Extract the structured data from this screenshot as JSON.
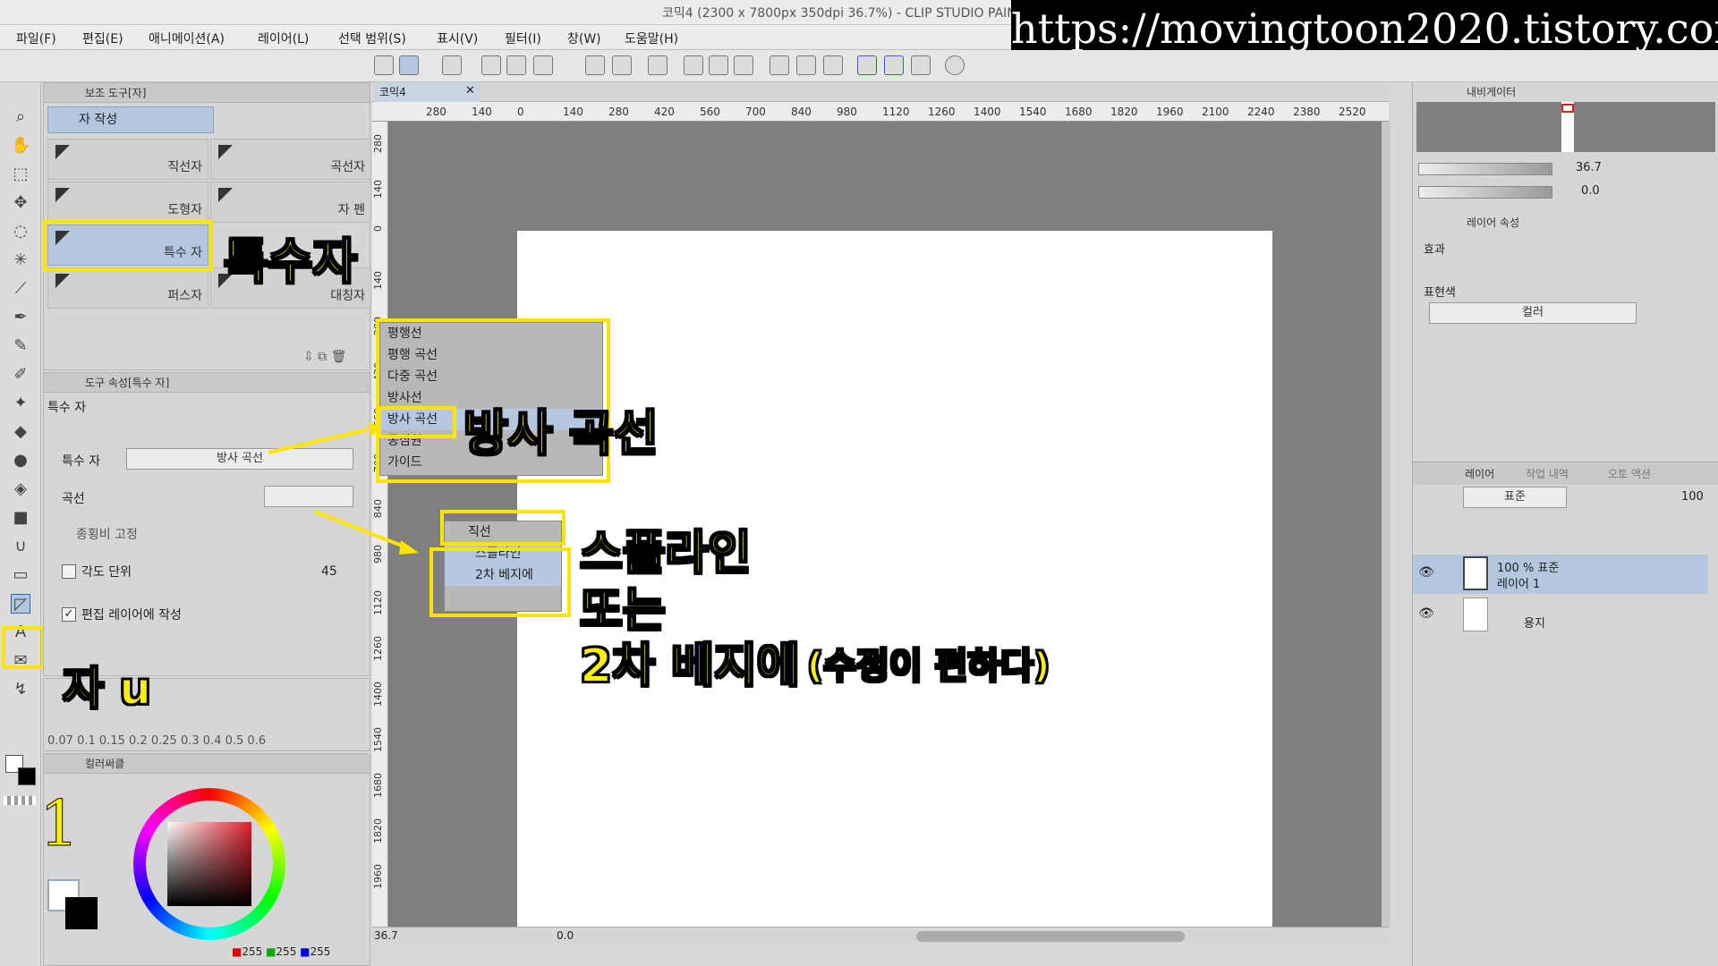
{
  "window": {
    "title": "코믹4 (2300 x 7800px 350dpi 36.7%)  - CLIP STUDIO PAINT"
  },
  "watermark": "https://movingtoon2020.tistory.com",
  "menu": [
    "파일(F)",
    "편집(E)",
    "애니메이션(A)",
    "레이어(L)",
    "선택 범위(S)",
    "표시(V)",
    "필터(I)",
    "창(W)",
    "도움말(H)"
  ],
  "subtool_panel": {
    "title": "보조 도구[자]",
    "group": "자 작성",
    "items": [
      "직선자",
      "곡선자",
      "도형자",
      "자 펜",
      "특수 자",
      "퍼스자",
      "대칭자"
    ],
    "selected": "특수 자"
  },
  "tool_property": {
    "title": "도구 속성[특수 자]",
    "tool_name": "특수 자",
    "rows": {
      "special_label": "특수 자",
      "special_value": "방사 곡선",
      "curve_label": "곡선",
      "aspect_label": "종횡비 고정",
      "angle_label": "각도 단위",
      "angle_value": "45",
      "edit_layer_label": "편집 레이어에 작성"
    }
  },
  "brush_sizes": [
    "0.07",
    "0.1",
    "0.15",
    "0.2",
    "0.25",
    "0.3",
    "0.4",
    "0.5",
    "0.6"
  ],
  "color_panel": {
    "title": "컬러써클",
    "rgb": [
      "255",
      "255",
      "255"
    ]
  },
  "canvas": {
    "tab": "코믹4",
    "ruler_h": [
      "280",
      "140",
      "0",
      "140",
      "280",
      "420",
      "560",
      "700",
      "840",
      "980",
      "1120",
      "1260",
      "1400",
      "1540",
      "1680",
      "1820",
      "1960",
      "2100",
      "2240",
      "2380",
      "2520"
    ],
    "ruler_v": [
      "280",
      "140",
      "0",
      "140",
      "280",
      "420",
      "560",
      "700",
      "840",
      "980",
      "1120",
      "1260",
      "1400",
      "1540",
      "1680",
      "1820",
      "1960"
    ],
    "zoom": "36.7",
    "rotate": "0.0"
  },
  "special_ruler_menu": [
    "평행선",
    "평행 곡선",
    "다중 곡선",
    "방사선",
    "방사 곡선",
    "동심원",
    "가이드"
  ],
  "curve_menu": [
    "직선",
    "스플라인",
    "2차 베지에"
  ],
  "annotations": {
    "special_ruler": "특수자",
    "radial_curve": "방사 곡선",
    "spline_line1": "스플라인",
    "spline_line2": "또는",
    "spline_line3": "2차 베지에",
    "spline_note": "(수정이 편하다)",
    "ruler_key": "자 u",
    "step": "1"
  },
  "navigator": {
    "title": "내비게이터",
    "zoom": "36.7",
    "angle": "0.0"
  },
  "layer_property": {
    "title": "레이어 속성",
    "effect_label": "효과",
    "expression_label": "표현색",
    "expression_value": "컬러"
  },
  "layers_panel": {
    "tabs": [
      "레이어",
      "작업 내역",
      "오토 액션"
    ],
    "blend": "표준",
    "opacity": "100",
    "layers": [
      {
        "name": "100 % 표준",
        "sub": "레이어 1"
      },
      {
        "name": "용지",
        "sub": ""
      }
    ]
  },
  "accent": {
    "highlight": "#ffe400",
    "selection": "#b3c7df"
  }
}
